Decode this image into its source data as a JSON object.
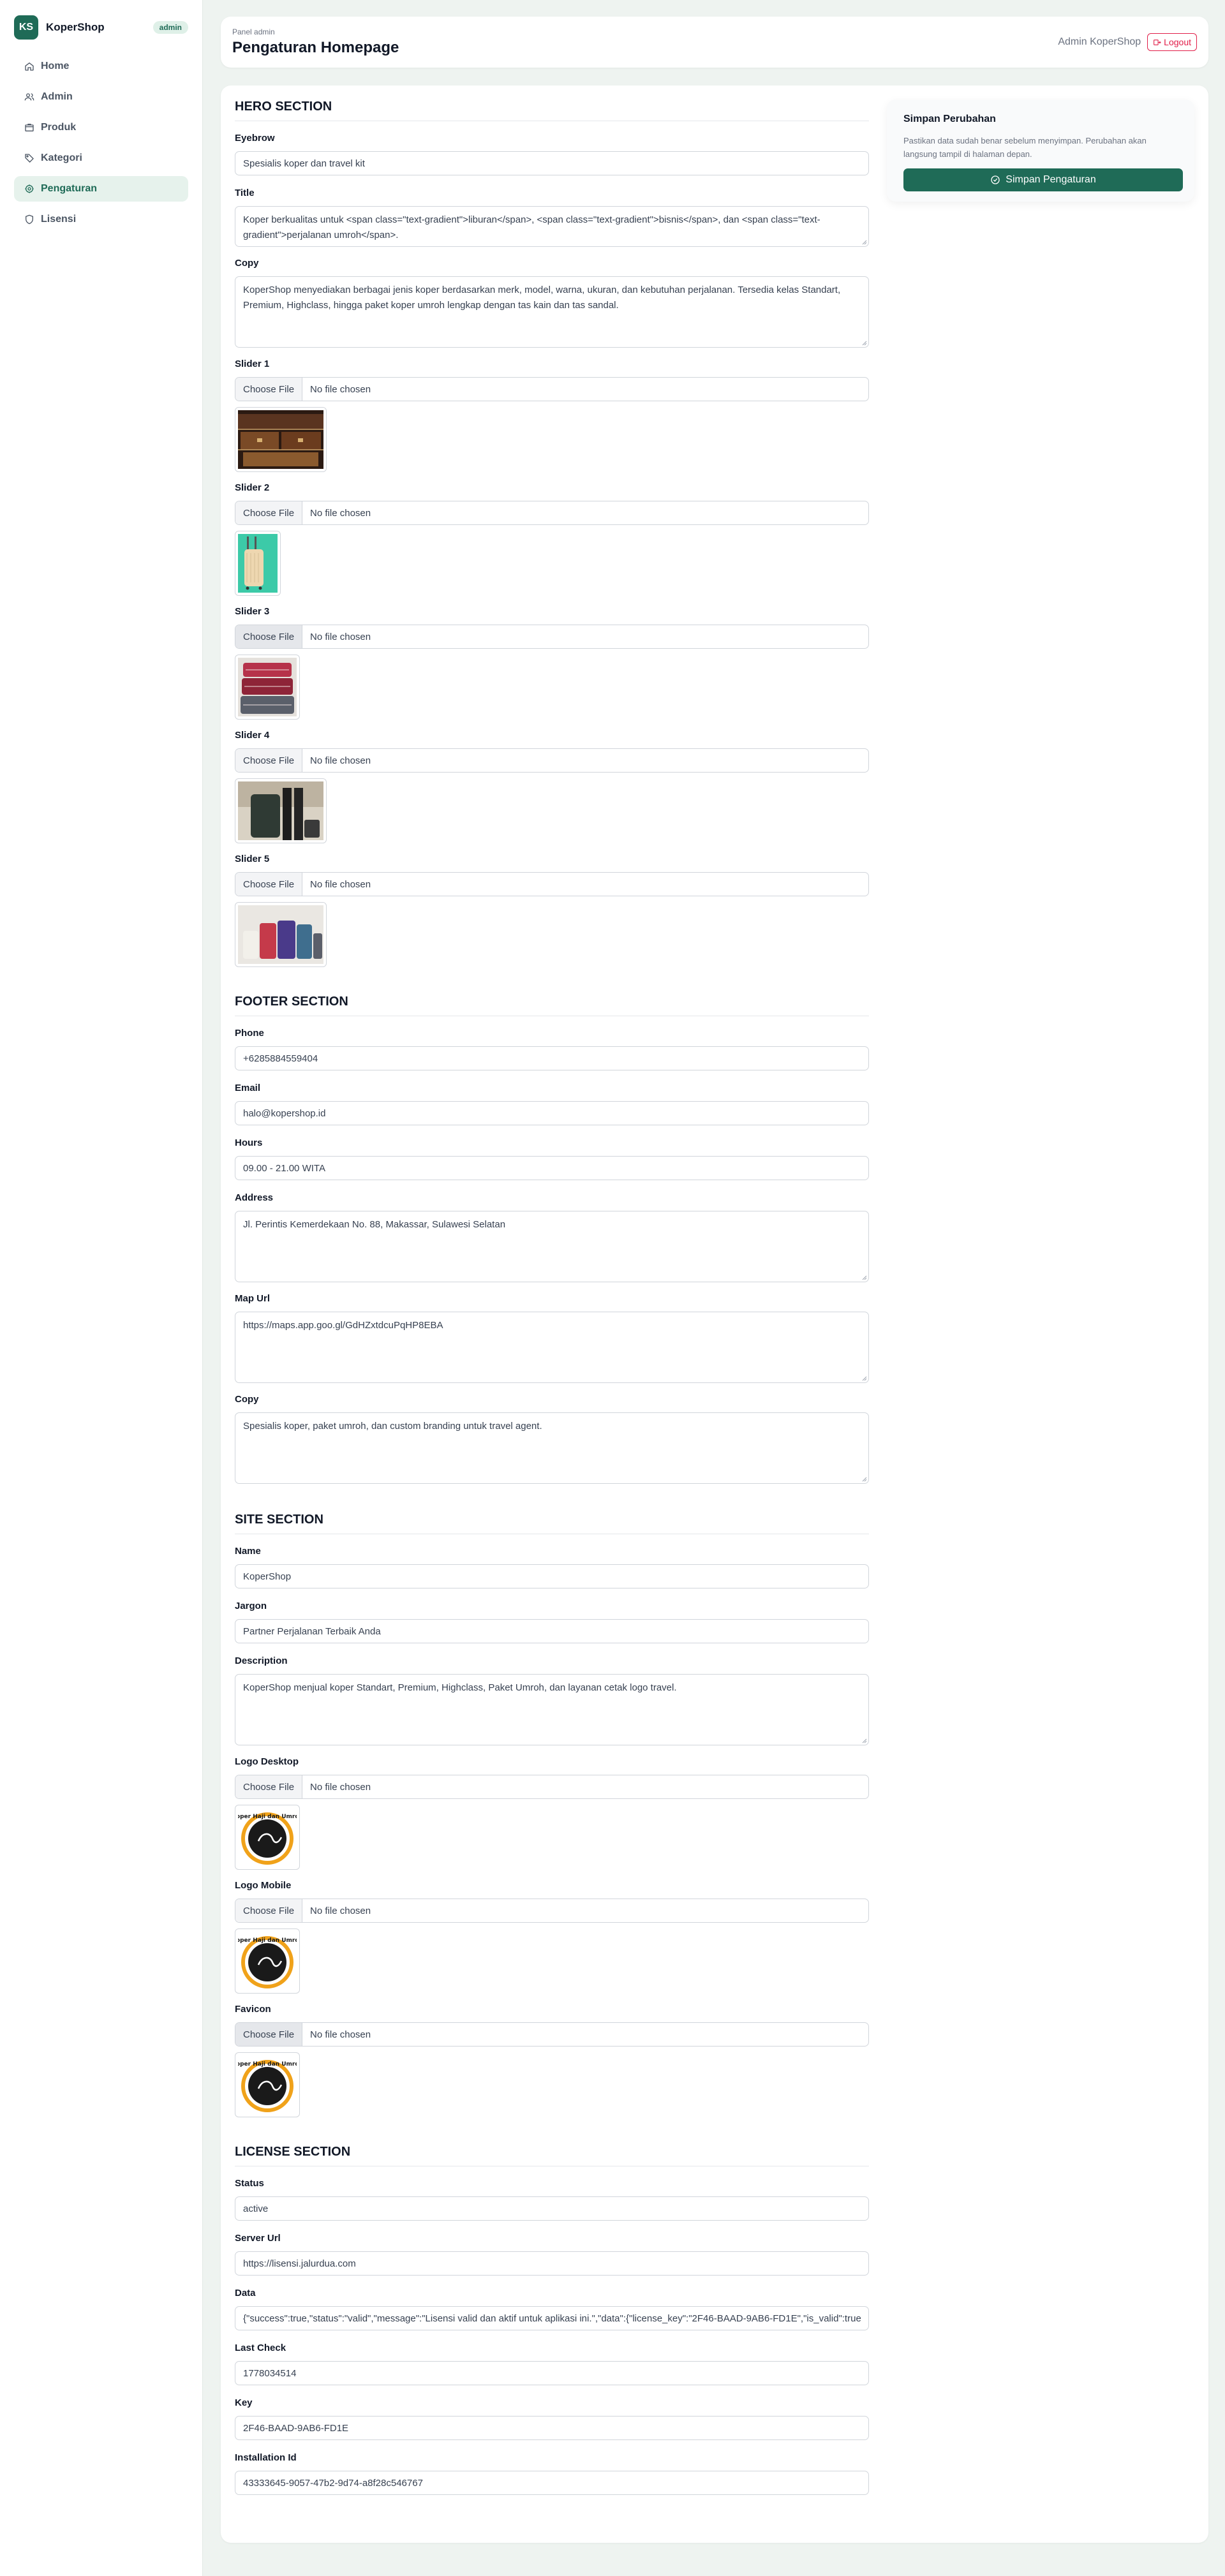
{
  "brand": {
    "logo": "KS",
    "name": "KoperShop",
    "badge": "admin"
  },
  "sidebar": {
    "items": [
      {
        "label": "Home",
        "icon": "home-icon"
      },
      {
        "label": "Admin",
        "icon": "users-icon"
      },
      {
        "label": "Produk",
        "icon": "box-icon"
      },
      {
        "label": "Kategori",
        "icon": "tag-icon"
      },
      {
        "label": "Pengaturan",
        "icon": "gear-icon",
        "active": true
      },
      {
        "label": "Lisensi",
        "icon": "shield-icon"
      }
    ]
  },
  "header": {
    "panel_label": "Panel admin",
    "title": "Pengaturan Homepage",
    "admin_name": "Admin KoperShop",
    "logout_label": "Logout"
  },
  "save_card": {
    "title": "Simpan Perubahan",
    "description": "Pastikan data sudah benar sebelum menyimpan. Perubahan akan langsung tampil di halaman depan.",
    "button_label": "Simpan Pengaturan"
  },
  "file_input": {
    "button_label": "Choose File",
    "status": "No file chosen"
  },
  "hero": {
    "section_title": "HERO SECTION",
    "eyebrow": {
      "label": "Eyebrow",
      "value": "Spesialis koper dan travel kit"
    },
    "title": {
      "label": "Title",
      "value": "Koper berkualitas untuk <span class=\"text-gradient\">liburan</span>, <span class=\"text-gradient\">bisnis</span>, dan <span class=\"text-gradient\">perjalanan umroh</span>."
    },
    "copy": {
      "label": "Copy",
      "value": "KoperShop menyediakan berbagai jenis koper berdasarkan merk, model, warna, ukuran, dan kebutuhan perjalanan. Tersedia kelas Standart, Premium, Highclass, hingga paket koper umroh lengkap dengan tas kain dan tas sandal."
    },
    "sliders": [
      {
        "label": "Slider 1"
      },
      {
        "label": "Slider 2"
      },
      {
        "label": "Slider 3"
      },
      {
        "label": "Slider 4"
      },
      {
        "label": "Slider 5"
      }
    ]
  },
  "footer": {
    "section_title": "FOOTER SECTION",
    "phone": {
      "label": "Phone",
      "value": "+6285884559404"
    },
    "email": {
      "label": "Email",
      "value": "halo@kopershop.id"
    },
    "hours": {
      "label": "Hours",
      "value": "09.00 - 21.00 WITA"
    },
    "address": {
      "label": "Address",
      "value": "Jl. Perintis Kemerdekaan No. 88, Makassar, Sulawesi Selatan"
    },
    "map_url": {
      "label": "Map Url",
      "value": "https://maps.app.goo.gl/GdHZxtdcuPqHP8EBA"
    },
    "copy": {
      "label": "Copy",
      "value": "Spesialis koper, paket umroh, dan custom branding untuk travel agent."
    }
  },
  "site": {
    "section_title": "SITE SECTION",
    "name": {
      "label": "Name",
      "value": "KoperShop"
    },
    "jargon": {
      "label": "Jargon",
      "value": "Partner Perjalanan Terbaik Anda"
    },
    "description": {
      "label": "Description",
      "value": "KoperShop menjual koper Standart, Premium, Highclass, Paket Umroh, dan layanan cetak logo travel."
    },
    "logo_desktop": {
      "label": "Logo Desktop"
    },
    "logo_mobile": {
      "label": "Logo Mobile"
    },
    "favicon": {
      "label": "Favicon"
    },
    "logo_text": "Koper Haji dan Umroh"
  },
  "license": {
    "section_title": "LICENSE SECTION",
    "status": {
      "label": "Status",
      "value": "active"
    },
    "server_url": {
      "label": "Server Url",
      "value": "https://lisensi.jalurdua.com"
    },
    "data": {
      "label": "Data",
      "value": "{\"success\":true,\"status\":\"valid\",\"message\":\"Lisensi valid dan aktif untuk aplikasi ini.\",\"data\":{\"license_key\":\"2F46-BAAD-9AB6-FD1E\",\"is_valid\":true"
    },
    "last_check": {
      "label": "Last Check",
      "value": "1778034514"
    },
    "key": {
      "label": "Key",
      "value": "2F46-BAAD-9AB6-FD1E"
    },
    "installation_id": {
      "label": "Installation Id",
      "value": "43333645-9057-47b2-9d74-a8f28c546767"
    }
  },
  "colors": {
    "brand": "#1f6b57",
    "danger": "#e11d48",
    "page_bg": "#eef3f0"
  }
}
